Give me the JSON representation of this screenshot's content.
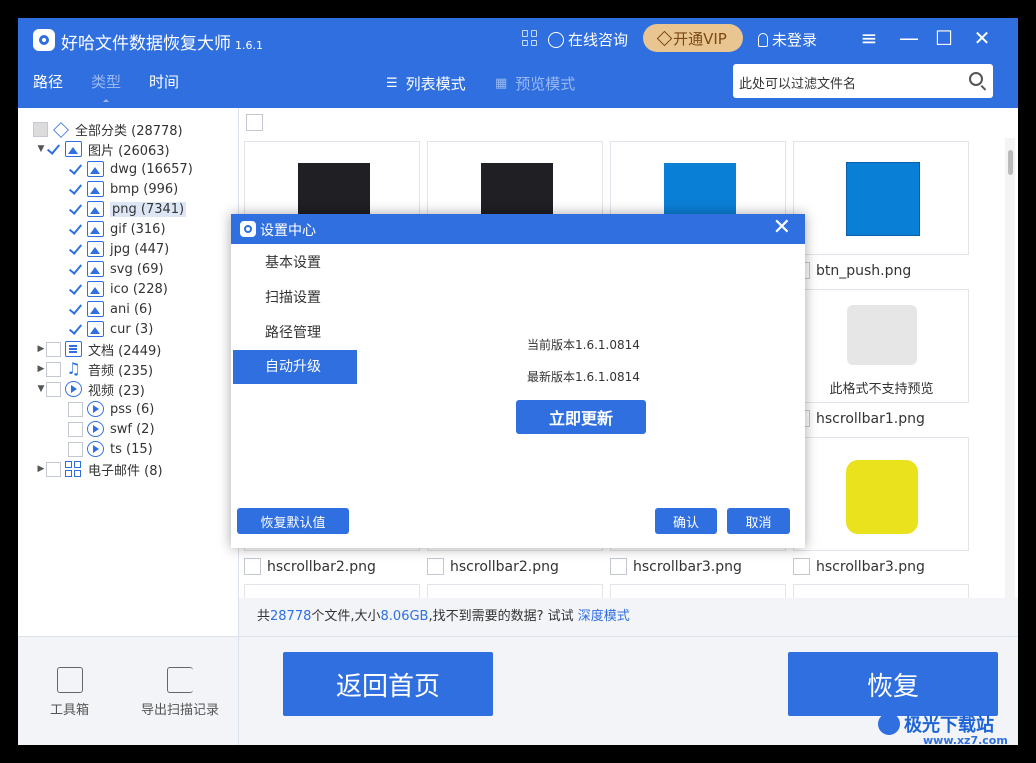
{
  "app": {
    "title": "好哈文件数据恢复大师",
    "version": "1.6.1",
    "consult_label": "在线咨询",
    "vip_label": "开通VIP",
    "login_label": "未登录",
    "icons": [
      "logo-icon",
      "grid-icon",
      "chat-icon",
      "diamond-icon",
      "user-icon",
      "menu-icon",
      "minimize-icon",
      "maximize-icon",
      "close-icon"
    ]
  },
  "nav": {
    "tabs": [
      {
        "label": "路径",
        "active": false
      },
      {
        "label": "类型",
        "active": true
      },
      {
        "label": "时间",
        "active": false
      }
    ],
    "view_modes": [
      {
        "label": "列表模式",
        "active": true
      },
      {
        "label": "预览模式",
        "active": false
      }
    ],
    "search_placeholder": "此处可以过滤文件名"
  },
  "tree": {
    "root": "全部分类 (28778)",
    "items": [
      {
        "label": "图片 (26063)",
        "checked": true,
        "expanded": true,
        "icon": "image-icon"
      },
      {
        "label": "dwg (16657)",
        "checked": true,
        "icon": "image-icon"
      },
      {
        "label": "bmp (996)",
        "checked": true,
        "icon": "image-icon"
      },
      {
        "label": "png (7341)",
        "checked": true,
        "icon": "image-icon",
        "selected": true
      },
      {
        "label": "gif (316)",
        "checked": true,
        "icon": "image-icon"
      },
      {
        "label": "jpg (447)",
        "checked": true,
        "icon": "image-icon"
      },
      {
        "label": "svg (69)",
        "checked": true,
        "icon": "image-icon"
      },
      {
        "label": "ico (228)",
        "checked": true,
        "icon": "image-icon"
      },
      {
        "label": "ani (6)",
        "checked": true,
        "icon": "image-icon"
      },
      {
        "label": "cur (3)",
        "checked": true,
        "icon": "image-icon"
      },
      {
        "label": "文档 (2449)",
        "checked": false,
        "icon": "document-icon"
      },
      {
        "label": "音频 (235)",
        "checked": false,
        "icon": "music-icon"
      },
      {
        "label": "视频 (23)",
        "checked": false,
        "expanded": true,
        "icon": "video-icon"
      },
      {
        "label": "pss (6)",
        "checked": false,
        "icon": "video-icon"
      },
      {
        "label": "swf (2)",
        "checked": false,
        "icon": "video-icon"
      },
      {
        "label": "ts (15)",
        "checked": false,
        "icon": "video-icon"
      },
      {
        "label": "电子邮件 (8)",
        "checked": false,
        "icon": "email-grid-icon"
      }
    ]
  },
  "grid": {
    "visible_names": [
      "btn_push.png",
      "hscrollbar1.png",
      "hscrollbar2.png",
      "hscrollbar2.png",
      "hscrollbar3.png",
      "hscrollbar3.png"
    ],
    "no_preview_text": "此格式不支持预览",
    "thumb_colors": {
      "dark": "#1f1f24",
      "blue": "#0a7fd6",
      "yellow": "#ebe21e"
    }
  },
  "status": {
    "prefix": "共",
    "count": "28778",
    "mid": "个文件,大小",
    "size": "8.06GB",
    "suffix": ",找不到需要的数据? 试试",
    "link": "深度模式"
  },
  "bottom": {
    "toolbox_label": "工具箱",
    "export_label": "导出扫描记录",
    "home_button": "返回首页",
    "recover_button": "恢复"
  },
  "dialog": {
    "title": "设置中心",
    "menu": [
      "基本设置",
      "扫描设置",
      "路径管理",
      "自动升级"
    ],
    "active_index": 3,
    "current_version": "当前版本1.6.1.0814",
    "latest_version": "最新版本1.6.1.0814",
    "update_button": "立即更新",
    "reset_button": "恢复默认值",
    "ok_button": "确认",
    "cancel_button": "取消"
  },
  "watermark": {
    "text": "极光下载站",
    "url": "www.xz7.com"
  },
  "colors": {
    "primary": "#2f6fe0",
    "vip": "#e9c591",
    "background": "#f2f4f7"
  }
}
